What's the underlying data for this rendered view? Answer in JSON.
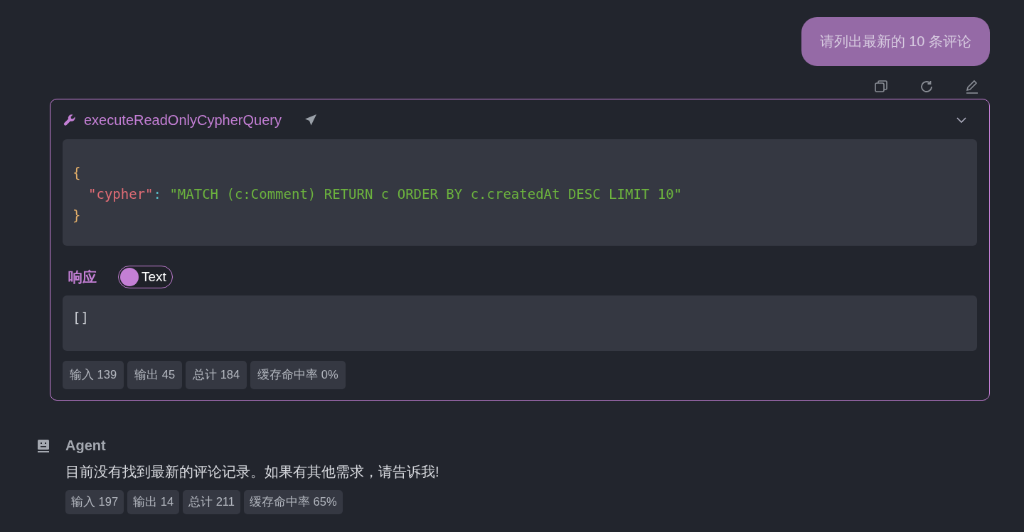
{
  "user_message": {
    "text": "请列出最新的 10 条评论"
  },
  "message_actions": [
    {
      "kind": "copy"
    },
    {
      "kind": "regenerate"
    },
    {
      "kind": "edit"
    }
  ],
  "tool_call": {
    "name": "executeReadOnlyCypherQuery",
    "expanded": true,
    "arguments": [
      [
        {
          "kind": "brace",
          "text": "{"
        }
      ],
      [
        {
          "kind": "key",
          "text": "\"cypher\""
        },
        {
          "kind": "punct",
          "text": ": "
        },
        {
          "kind": "string",
          "text": "\"MATCH (c:Comment) RETURN c ORDER BY c.createdAt DESC LIMIT 10\""
        }
      ],
      [
        {
          "kind": "brace",
          "text": "}"
        }
      ]
    ],
    "response_label": "响应",
    "response_toggle": {
      "label": "Text",
      "on": false
    },
    "response": "[]",
    "stats": [
      "输入 139",
      "输出 45",
      "总计 184",
      "缓存命中率 0%"
    ]
  },
  "agent": {
    "name": "Agent",
    "text": "目前没有找到最新的评论记录。如果有其他需求，请告诉我!",
    "stats": [
      "输入 197",
      "输出 14",
      "总计 211",
      "缓存命中率 65%"
    ]
  }
}
